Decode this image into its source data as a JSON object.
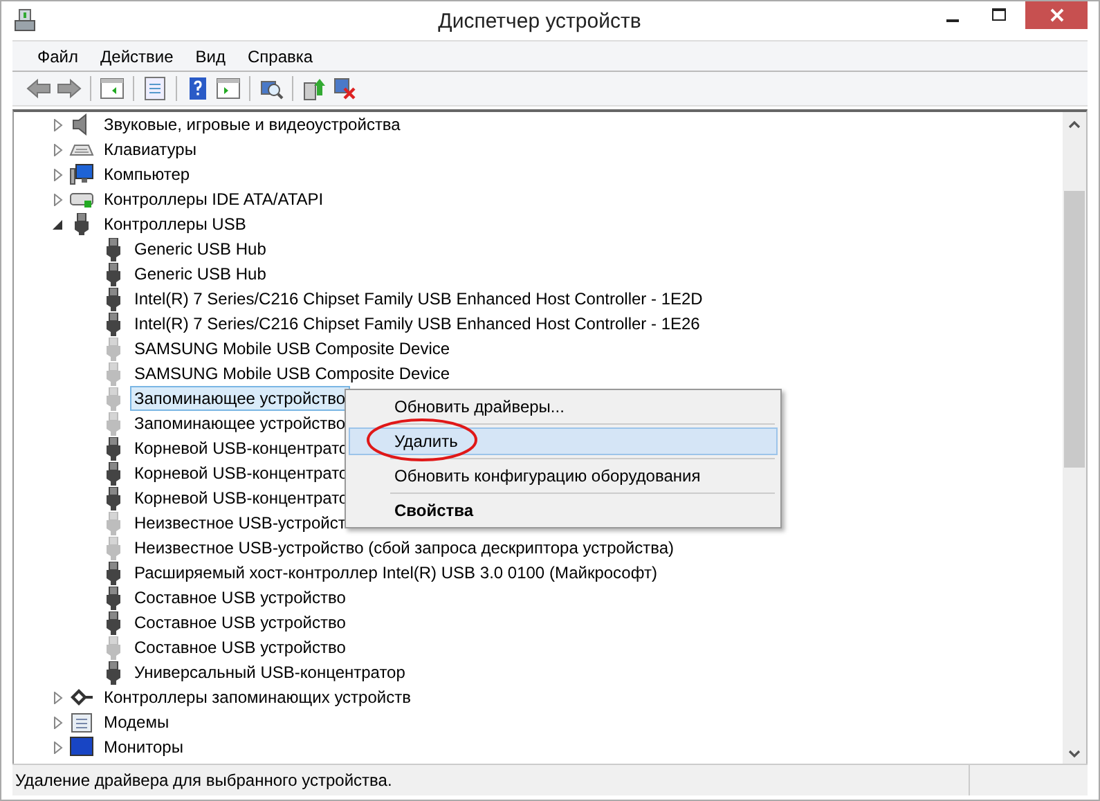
{
  "window": {
    "title": "Диспетчер устройств"
  },
  "menu_bar": [
    "Файл",
    "Действие",
    "Вид",
    "Справка"
  ],
  "tree": [
    {
      "label": "Звуковые, игровые и видеоустройства",
      "kind": "sound",
      "expanded": false
    },
    {
      "label": "Клавиатуры",
      "kind": "keyboard",
      "expanded": false
    },
    {
      "label": "Компьютер",
      "kind": "computer",
      "expanded": false
    },
    {
      "label": "Контроллеры IDE ATA/ATAPI",
      "kind": "ide",
      "expanded": false
    },
    {
      "label": "Контроллеры USB",
      "kind": "usb",
      "expanded": true,
      "children": [
        {
          "label": "Generic USB Hub",
          "dimmed": false,
          "selected": false
        },
        {
          "label": "Generic USB Hub",
          "dimmed": false,
          "selected": false
        },
        {
          "label": "Intel(R) 7 Series/C216 Chipset Family USB Enhanced Host Controller - 1E2D",
          "dimmed": false,
          "selected": false
        },
        {
          "label": "Intel(R) 7 Series/C216 Chipset Family USB Enhanced Host Controller - 1E26",
          "dimmed": false,
          "selected": false
        },
        {
          "label": "SAMSUNG Mobile USB Composite Device",
          "dimmed": true,
          "selected": false
        },
        {
          "label": "SAMSUNG Mobile USB Composite Device",
          "dimmed": true,
          "selected": false
        },
        {
          "label": "Запоминающее устройство",
          "dimmed": true,
          "selected": true
        },
        {
          "label": "Запоминающее устройство",
          "dimmed": true,
          "selected": false
        },
        {
          "label": "Корневой USB-концентрато",
          "dimmed": false,
          "selected": false
        },
        {
          "label": "Корневой USB-концентрато",
          "dimmed": false,
          "selected": false
        },
        {
          "label": "Корневой USB-концентрато",
          "dimmed": false,
          "selected": false
        },
        {
          "label": "Неизвестное USB-устройст",
          "dimmed": true,
          "selected": false
        },
        {
          "label": "Неизвестное USB-устройство (сбой запроса дескриптора устройства)",
          "dimmed": true,
          "selected": false
        },
        {
          "label": "Расширяемый хост-контроллер Intel(R) USB 3.0 0100 (Майкрософт)",
          "dimmed": false,
          "selected": false
        },
        {
          "label": "Составное USB устройство",
          "dimmed": false,
          "selected": false
        },
        {
          "label": "Составное USB устройство",
          "dimmed": false,
          "selected": false
        },
        {
          "label": "Составное USB устройство",
          "dimmed": true,
          "selected": false
        },
        {
          "label": "Универсальный USB-концентратор",
          "dimmed": false,
          "selected": false
        }
      ]
    },
    {
      "label": "Контроллеры запоминающих устройств",
      "kind": "storage",
      "expanded": false
    },
    {
      "label": "Модемы",
      "kind": "modem",
      "expanded": false
    },
    {
      "label": "Мониторы",
      "kind": "monitor",
      "expanded": false
    }
  ],
  "context_menu": [
    {
      "kind": "item",
      "label": "Обновить драйверы...",
      "selected": false
    },
    {
      "kind": "separator"
    },
    {
      "kind": "item",
      "label": "Удалить",
      "selected": true,
      "circled": true
    },
    {
      "kind": "separator"
    },
    {
      "kind": "item",
      "label": "Обновить конфигурацию оборудования",
      "selected": false
    },
    {
      "kind": "separator"
    },
    {
      "kind": "default",
      "label": "Свойства",
      "selected": false
    }
  ],
  "status_bar": "Удаление драйвера для выбранного устройства."
}
